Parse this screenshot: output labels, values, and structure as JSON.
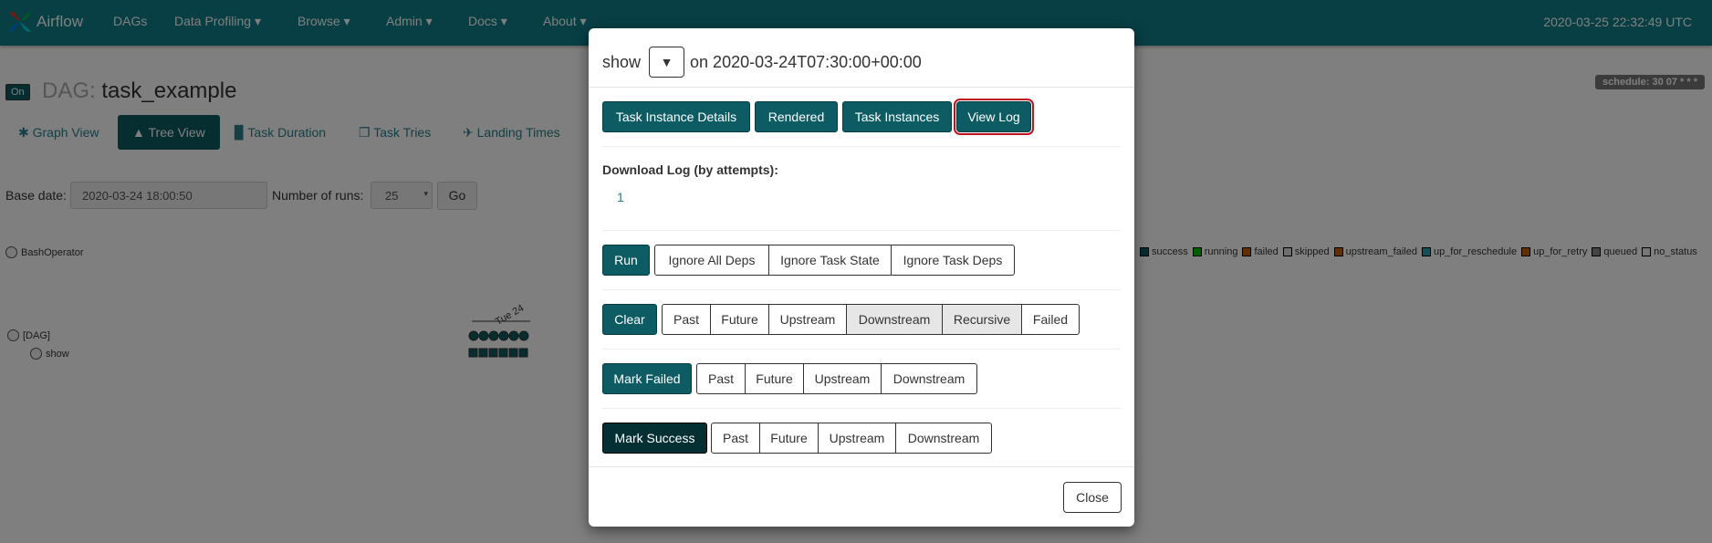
{
  "navbar": {
    "brand": "Airflow",
    "items": [
      "DAGs",
      "Data Profiling",
      "Browse",
      "Admin",
      "Docs",
      "About"
    ],
    "clock": "2020-03-25 22:32:49 UTC"
  },
  "dag": {
    "toggle": "On",
    "prefix": "DAG:",
    "name": "task_example",
    "schedule": "schedule: 30 07 * * *"
  },
  "views": [
    "Graph View",
    "Tree View",
    "Task Duration",
    "Task Tries",
    "Landing Times"
  ],
  "form": {
    "base_date_label": "Base date:",
    "base_date_value": "2020-03-24 18:00:50",
    "runs_label": "Number of runs:",
    "runs_value": "25",
    "go": "Go"
  },
  "operator_legend": "BashOperator",
  "state_legend": [
    "success",
    "running",
    "failed",
    "skipped",
    "upstream_failed",
    "up_for_reschedule",
    "up_for_retry",
    "queued",
    "no_status"
  ],
  "state_colors": [
    "#0d5c63",
    "#00c000",
    "#c06000",
    "#ddd",
    "#c06000",
    "#2a9fb0",
    "#c06000",
    "#888",
    "#f0f0f0"
  ],
  "tree": {
    "dag_node": "[DAG]",
    "task_node": "show",
    "date_label": "Tue 24"
  },
  "modal": {
    "task": "show",
    "execution": "on 2020-03-24T07:30:00+00:00",
    "tabs": [
      "Task Instance Details",
      "Rendered",
      "Task Instances",
      "View Log"
    ],
    "download_label": "Download Log (by attempts):",
    "attempt": "1",
    "run": {
      "primary": "Run",
      "options": [
        "Ignore All Deps",
        "Ignore Task State",
        "Ignore Task Deps"
      ]
    },
    "clear": {
      "primary": "Clear",
      "options": [
        "Past",
        "Future",
        "Upstream",
        "Downstream",
        "Recursive",
        "Failed"
      ]
    },
    "mark_failed": {
      "primary": "Mark Failed",
      "options": [
        "Past",
        "Future",
        "Upstream",
        "Downstream"
      ]
    },
    "mark_success": {
      "primary": "Mark Success",
      "options": [
        "Past",
        "Future",
        "Upstream",
        "Downstream"
      ]
    },
    "close": "Close"
  }
}
